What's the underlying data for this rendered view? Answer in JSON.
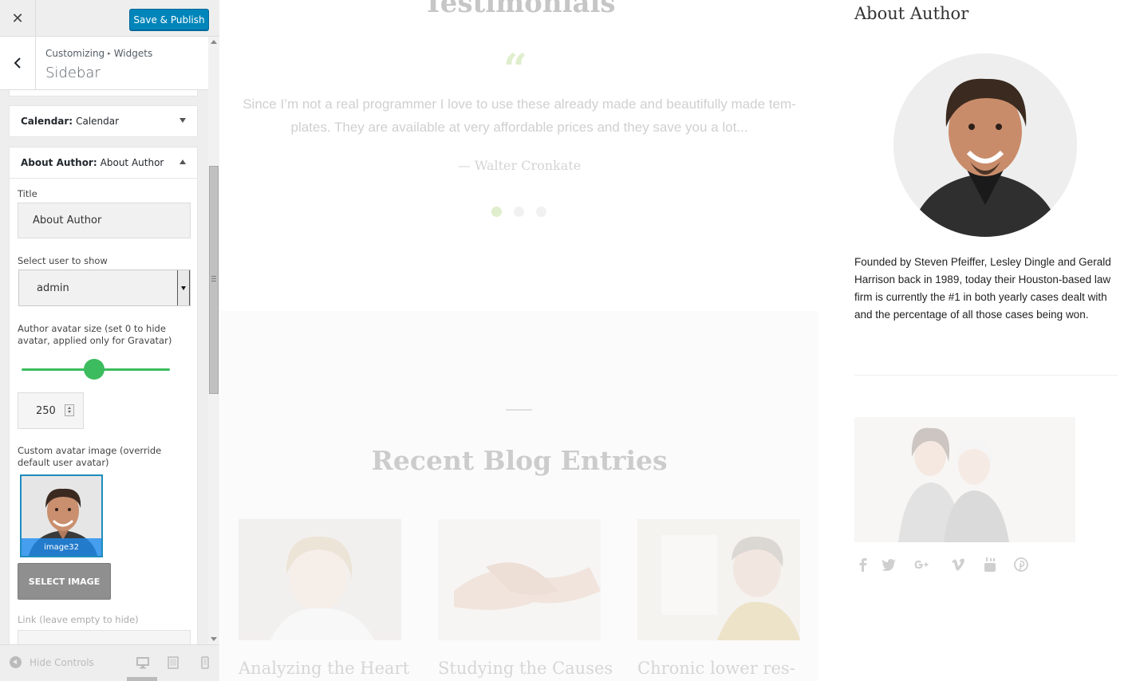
{
  "customizer": {
    "close_label": "✕",
    "save_label": "Save & Publish",
    "breadcrumb": {
      "first": "Customizing",
      "separator": "▸",
      "second": "Widgets"
    },
    "section_name": "Sidebar",
    "widgets": [
      {
        "type": "Calendar:",
        "title": "Calendar",
        "expanded": false
      },
      {
        "type": "About Author:",
        "title": "About Author",
        "expanded": true
      }
    ],
    "about_author_form": {
      "title_label": "Title",
      "title_value": "About Author",
      "user_label": "Select user to show",
      "user_value": "admin",
      "avatar_size_label": "Author avatar size (set 0 to hide avatar, applied only for Gravatar)",
      "avatar_size_value": "250",
      "avatar_size_slider_fraction": 0.49,
      "custom_avatar_label": "Custom avatar image (override default user avatar)",
      "avatar_caption": "image32",
      "select_image_label": "SELECT IMAGE",
      "link_label": "Link (leave empty to hide)",
      "link_value": ""
    },
    "footer": {
      "hide_controls_label": "Hide Controls"
    },
    "colors": {
      "primary": "#0085ba",
      "slider": "#3cbc5e",
      "selected_image": "#1e8cbe"
    }
  },
  "preview": {
    "testimonials_title": "Testimonials",
    "quote_mark": "“",
    "testimonial_text": "Since I’m not a real programmer I love to use these already made and beautifully made tem-plates. They are available at very affordable prices and they save you a lot...",
    "testimonial_author": "— Walter Cronkate",
    "active_slide": 1,
    "slide_count": 3,
    "blog_title": "Recent Blog Entries",
    "blog_posts": [
      {
        "caption": "Analyzing the Heart"
      },
      {
        "caption": "Studying the Causes"
      },
      {
        "caption": "Chronic lower res-"
      }
    ],
    "sidebar_title": "About Author",
    "author_bio": "Founded by Steven Pfeiffer, Lesley Dingle and Gerald Harrison back in 1989, today their Houston-based law firm is currently the #1 in both yearly cases dealt with and the percentage of all those cases being won.",
    "social_icons": [
      "facebook-icon",
      "twitter-icon",
      "google-plus-icon",
      "vimeo-icon",
      "youtube-icon",
      "pinterest-icon"
    ],
    "accent_color": "#8bc34a"
  }
}
